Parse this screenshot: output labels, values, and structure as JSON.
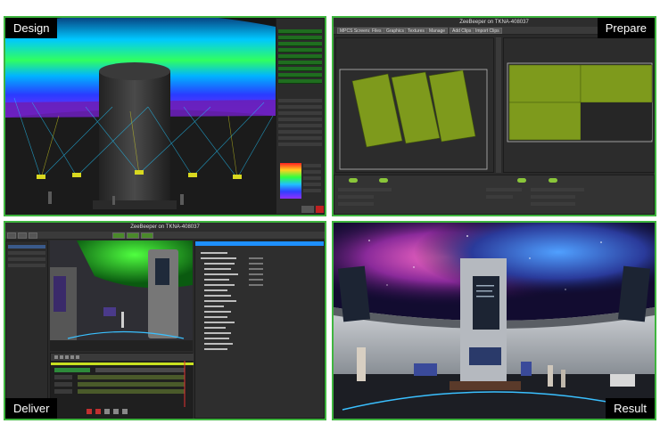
{
  "quadrants": {
    "design": {
      "label": "Design"
    },
    "prepare": {
      "label": "Prepare",
      "window_title": "ZeeBeeper on TKNA-408037",
      "toolbar": [
        "MPCS Screens",
        "Files",
        "Graphics",
        "Textures",
        "Manage",
        "Add Clips",
        "Import Clips"
      ]
    },
    "deliver": {
      "label": "Deliver",
      "window_title": "ZeeBeeper on TKNA-408037"
    },
    "result": {
      "label": "Result"
    }
  },
  "colors": {
    "frame_border": "#3fb53f",
    "label_bg": "#000000",
    "label_text": "#ffffff",
    "mesh_green": "#7e9a1c",
    "accent_blue": "#1e90ff"
  },
  "icons": [
    "dome-projection-render",
    "projector-frustum-lines",
    "mesh-tile-icon",
    "timeline-track",
    "galaxy-ceiling-render"
  ]
}
